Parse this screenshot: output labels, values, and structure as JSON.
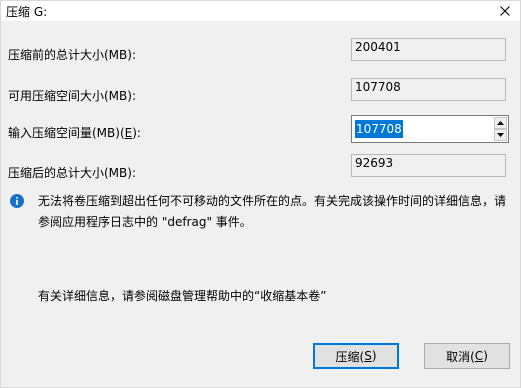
{
  "window": {
    "title": "压缩 G:"
  },
  "fields": {
    "total_before_label": "压缩前的总计大小(MB):",
    "total_before_value": "200401",
    "available_label": "可用压缩空间大小(MB):",
    "available_value": "107708",
    "amount_label_prefix": "输入压缩空间量(MB)(",
    "amount_label_key": "E",
    "amount_label_suffix": "):",
    "amount_value": "107708",
    "total_after_label": "压缩后的总计大小(MB):",
    "total_after_value": "92693"
  },
  "info": {
    "line1": "无法将卷压缩到超出任何不可移动的文件所在的点。有关完成该操作时间的详细信息，请",
    "line2": "参阅应用程序日志中的 \"defrag\" 事件。"
  },
  "help": {
    "text": "有关详细信息，请参阅磁盘管理帮助中的“收缩基本卷”"
  },
  "buttons": {
    "shrink_prefix": "压缩(",
    "shrink_key": "S",
    "shrink_suffix": ")",
    "cancel_prefix": "取消(",
    "cancel_key": "C",
    "cancel_suffix": ")"
  },
  "colors": {
    "accent": "#0078d7",
    "info_icon": "#1a6fc7"
  }
}
